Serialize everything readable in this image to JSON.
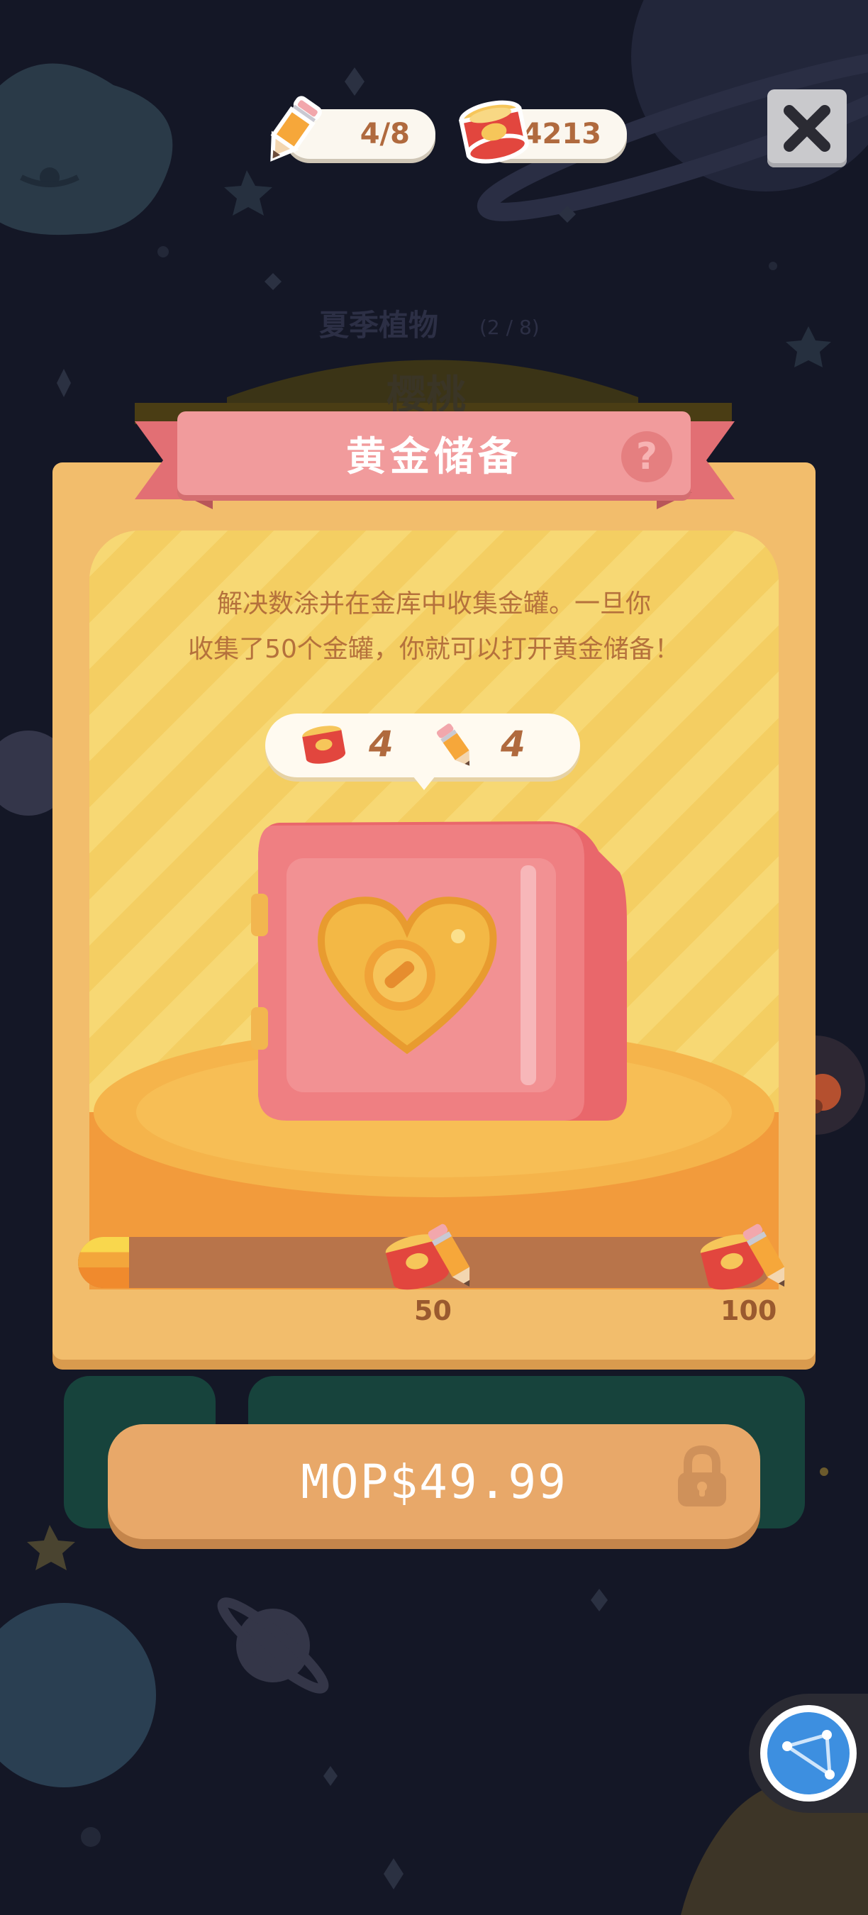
{
  "hud": {
    "pencil_count": "4/8",
    "can_count": "4213"
  },
  "background": {
    "collection_title": "夏季植物",
    "collection_progress": "(2 / 8)",
    "plant_name": "樱桃"
  },
  "modal": {
    "title": "黄金储备",
    "help_glyph": "?",
    "description_line1": "解决数涂并在金库中收集金罐。一旦你",
    "description_line2": "收集了50个金罐，你就可以打开黄金储备！",
    "reward_cans": "4",
    "reward_pencils": "4",
    "progress": {
      "current": 4,
      "milestones": [
        {
          "label": "50",
          "value": 50
        },
        {
          "label": "100",
          "value": 100
        }
      ]
    }
  },
  "purchase": {
    "price_label": "MOP$49.99",
    "locked": true
  },
  "colors": {
    "background": "#141726",
    "card": "#f2bd6c",
    "ribbon": "#f19b9c",
    "button": "#e8a869",
    "safe": "#ec7f80",
    "text_brown": "#b06a3e"
  },
  "icons": {
    "close": "close-icon",
    "pencil": "pencil-icon",
    "can": "gold-can-icon",
    "lock": "lock-icon",
    "help": "help-icon",
    "safe": "heart-safe-icon",
    "assist": "network-assist-icon"
  }
}
